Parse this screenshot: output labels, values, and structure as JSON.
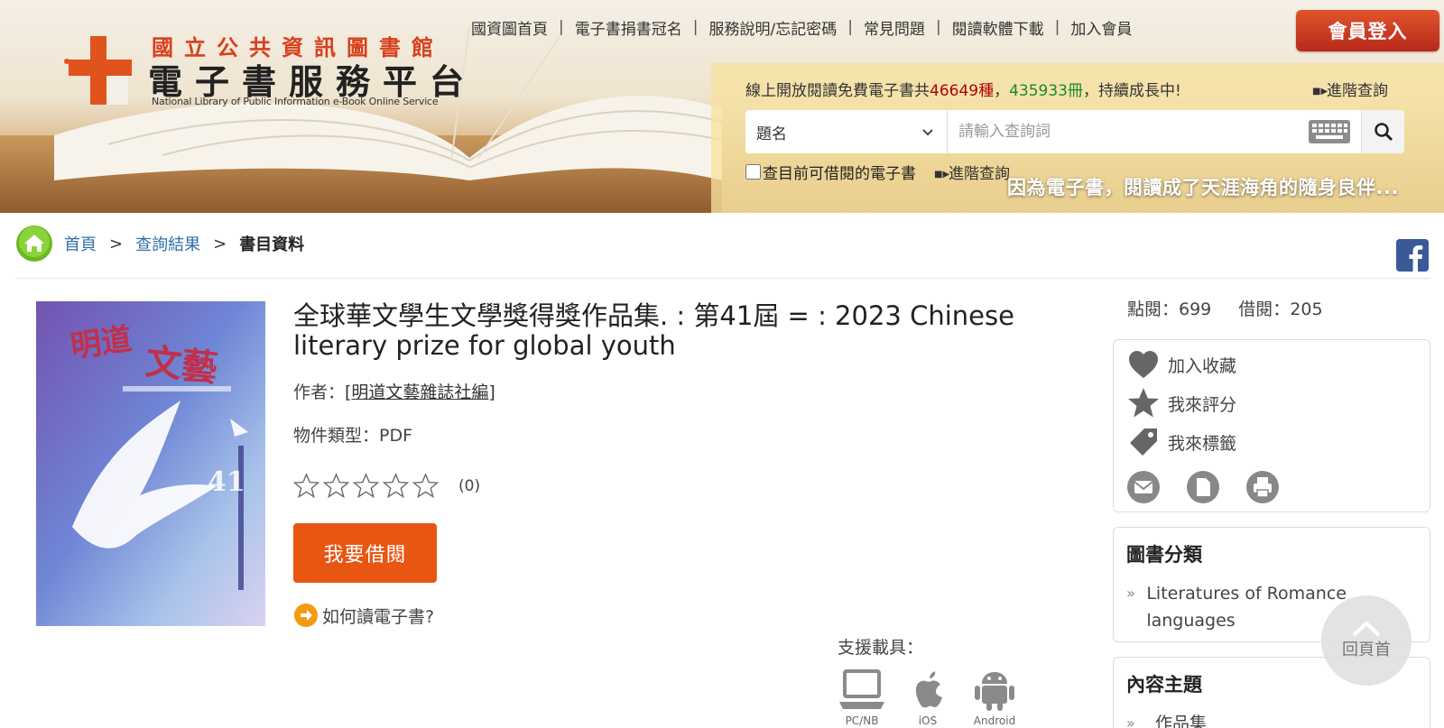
{
  "header": {
    "logo_line1": "國立公共資訊圖書館",
    "logo_line2": "電子書服務平台",
    "logo_line3": "National Library of Public Information e-Book Online Service",
    "nav": [
      "國資圖首頁",
      "電子書捐書冠名",
      "服務說明/忘記密碼",
      "常見問題",
      "閱讀軟體下載",
      "加入會員"
    ],
    "login_label": "會員登入",
    "stats_prefix": "線上開放閱讀免費電子書共",
    "stats_kinds": "46649種",
    "stats_sep": "，",
    "stats_volumes": "435933冊",
    "stats_suffix": "，持續成長中!",
    "advanced_search": "進階查詢",
    "search_field": "題名",
    "search_placeholder": "請輸入查詢詞",
    "available_only": "查目前可借閱的電子書",
    "advanced_search_2": "進階查詢",
    "slogan": "因為電子書，閱讀成了天涯海角的隨身良伴..."
  },
  "breadcrumb": {
    "home": "首頁",
    "results": "查詢結果",
    "current": "書目資料"
  },
  "book": {
    "title": "全球華文學生文學獎得獎作品集. : 第41屆 = : 2023 Chinese literary prize for global youth",
    "author_label": "作者：",
    "author": "[明道文藝雜誌社編]",
    "type_label": "物件類型：",
    "type": "PDF",
    "rating_count": "(0)",
    "rating_value": 0,
    "rating_max": 5,
    "borrow_label": "我要借閱",
    "howto_label": "如何讀電子書?",
    "devices_label": "支援載具：",
    "devices": [
      "PC/NB",
      "iOS",
      "Android"
    ]
  },
  "sidebar": {
    "views": "點閱：699",
    "borrows": "借閱：205",
    "favorite": "加入收藏",
    "rate": "我來評分",
    "tag": "我來標籤",
    "classification_title": "圖書分類",
    "classification_item": "Literatures of Romance languages",
    "subject_title": "內容主題",
    "subject_item": "作品集"
  },
  "back_to_top": "回頁首",
  "colors": {
    "brand_red": "#d8401c",
    "login_bg": "#c0321c",
    "borrow_bg": "#e85712",
    "link_blue": "#2f6fa8",
    "stats_red": "#b00000",
    "stats_green": "#1a8a2a"
  }
}
